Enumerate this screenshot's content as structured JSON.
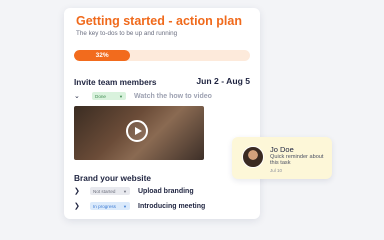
{
  "plan": {
    "title": "Getting started - action plan",
    "subtitle": "The key to-dos to be up and running",
    "progress": {
      "percent": 32,
      "label": "32%"
    }
  },
  "sections": [
    {
      "title": "Invite team members",
      "dates": "Jun 2 - Aug 5",
      "tasks": [
        {
          "status": "Done",
          "label": "Watch the how to video"
        }
      ],
      "video": {
        "icon": "play-icon"
      }
    },
    {
      "title": "Brand your website",
      "tasks": [
        {
          "status": "Not started",
          "label": "Upload branding"
        },
        {
          "status": "In progress",
          "label": "Introducing meeting"
        }
      ]
    }
  ],
  "notification": {
    "name": "Jo Doe",
    "message": "Quick reminder about this task",
    "time": "Jul 10"
  },
  "colors": {
    "accent": "#f26b1d",
    "done_badge": "#d9f2dd",
    "not_started_badge": "#e8e9ee",
    "in_progress_badge": "#dbeafb",
    "notification_bg": "#fdf7d8"
  }
}
